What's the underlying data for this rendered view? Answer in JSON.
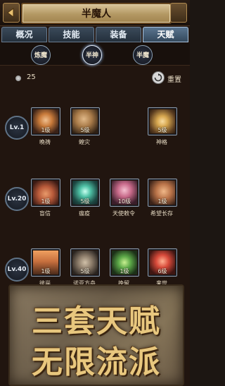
{
  "header": {
    "title": "半魔人"
  },
  "tabs": [
    {
      "label": "概况",
      "active": false
    },
    {
      "label": "技能",
      "active": false
    },
    {
      "label": "装备",
      "active": false
    },
    {
      "label": "天赋",
      "active": true
    }
  ],
  "trees": [
    {
      "label": "炼魔",
      "active": false
    },
    {
      "label": "半神",
      "active": true
    },
    {
      "label": "半魔",
      "active": false
    }
  ],
  "points": {
    "value": "25",
    "reset_label": "重置"
  },
  "levels": [
    "Lv.1",
    "Lv.20",
    "Lv.40"
  ],
  "skills": [
    {
      "level": "1级",
      "name": "晚祷",
      "icon": "fire-orb-icon",
      "color": "#c87a3a"
    },
    {
      "level": "5级",
      "name": "蝗灾",
      "icon": "locust-swarm-icon",
      "color": "#a87a48"
    },
    {
      "level": "5级",
      "name": "神格",
      "icon": "divine-sigil-icon",
      "color": "#d8a850"
    },
    {
      "level": "1级",
      "name": "盲信",
      "icon": "blood-altar-icon",
      "color": "#b85a3a"
    },
    {
      "level": "5级",
      "name": "瘟疫",
      "icon": "plague-orb-icon",
      "color": "#4fc2a6"
    },
    {
      "level": "10级",
      "name": "天使敕令",
      "icon": "angel-wings-icon",
      "color": "#c86a8a"
    },
    {
      "level": "1级",
      "name": "希望长存",
      "icon": "hope-figure-icon",
      "color": "#b87248"
    },
    {
      "level": "1级",
      "name": "彼岸",
      "icon": "far-shore-icon",
      "color": "#c8703e"
    },
    {
      "level": "5级",
      "name": "诺亚方舟",
      "icon": "ark-icon",
      "color": "#8a7a68"
    },
    {
      "level": "1级",
      "name": "挽留",
      "icon": "emerald-seal-icon",
      "color": "#5ca848"
    },
    {
      "level": "6级",
      "name": "来世",
      "icon": "afterlife-blade-icon",
      "color": "#d84a3a"
    }
  ],
  "banner": {
    "line1": "三套天赋",
    "line2": "无限流派"
  }
}
